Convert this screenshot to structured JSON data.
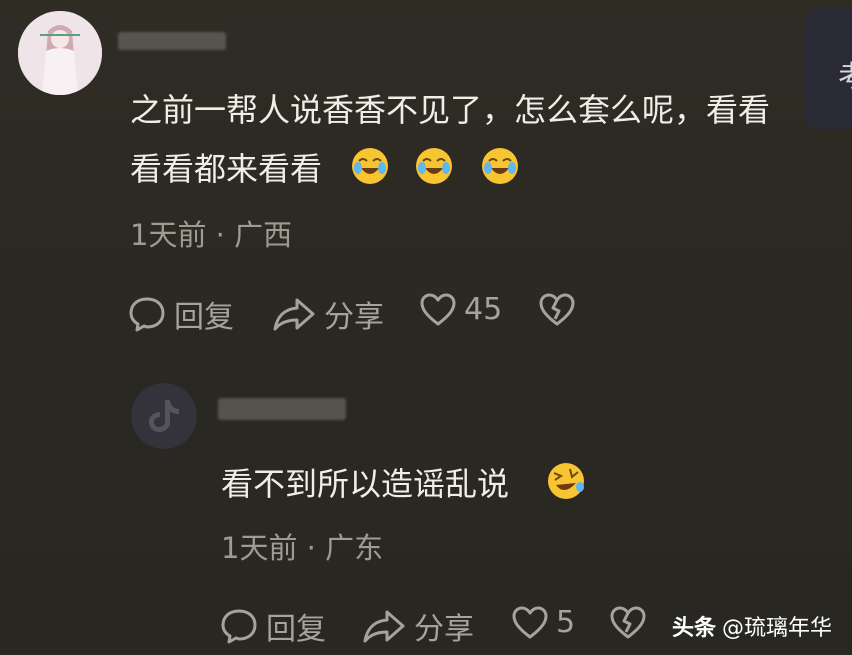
{
  "comment1": {
    "avatar": "avatar-illustration",
    "text_line1": "之前一帮人说香香不见了，怎么套么呢，看看",
    "text_line2": "看看都来看看",
    "emojis": [
      "crying-laughing-emoji",
      "crying-laughing-emoji",
      "crying-laughing-emoji"
    ],
    "time": "1天前",
    "location": "广西",
    "separator": "·",
    "reply_label": "回复",
    "share_label": "分享",
    "likes": "45"
  },
  "comment2": {
    "text": "看不到所以造谣乱说",
    "emoji": "rolling-laughing-emoji",
    "time": "1天前",
    "location": "广东",
    "separator": "·",
    "reply_label": "回复",
    "share_label": "分享",
    "likes": "5"
  },
  "side_panel": {
    "char": "考"
  },
  "watermark": {
    "brand": "头条",
    "handle": "@琉璃年华"
  },
  "colors": {
    "background": "#2c2a24",
    "text": "#f1eee8",
    "meta": "#a09b92"
  }
}
